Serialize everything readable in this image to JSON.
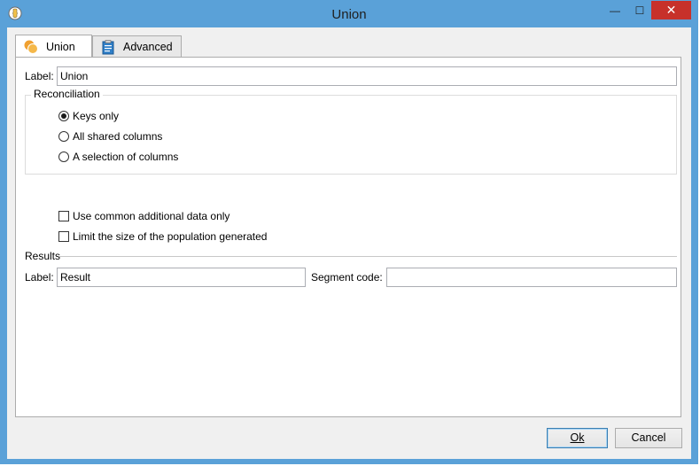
{
  "window": {
    "title": "Union"
  },
  "titlebar_buttons": {
    "minimize": "—",
    "maximize": "☐",
    "close": "✕"
  },
  "tabs": [
    {
      "label": "Union",
      "icon": "union-circles-icon",
      "selected": true
    },
    {
      "label": "Advanced",
      "icon": "clipboard-icon",
      "selected": false
    }
  ],
  "label_field": {
    "label": "Label:",
    "value": "Union"
  },
  "reconciliation": {
    "title": "Reconciliation",
    "options": [
      {
        "label": "Keys only",
        "checked": true
      },
      {
        "label": "All shared columns",
        "checked": false
      },
      {
        "label": "A selection of columns",
        "checked": false
      }
    ]
  },
  "options": [
    {
      "label": "Use common additional data only",
      "checked": false
    },
    {
      "label": "Limit the size of the population generated",
      "checked": false
    }
  ],
  "results": {
    "title": "Results",
    "label": "Label:",
    "label_value": "Result",
    "segment_label": "Segment code:",
    "segment_value": ""
  },
  "buttons": {
    "ok": "Ok",
    "cancel": "Cancel"
  },
  "colors": {
    "titlebar": "#5aa1d8",
    "close": "#c7312a",
    "union_icon": "#f0a030"
  }
}
